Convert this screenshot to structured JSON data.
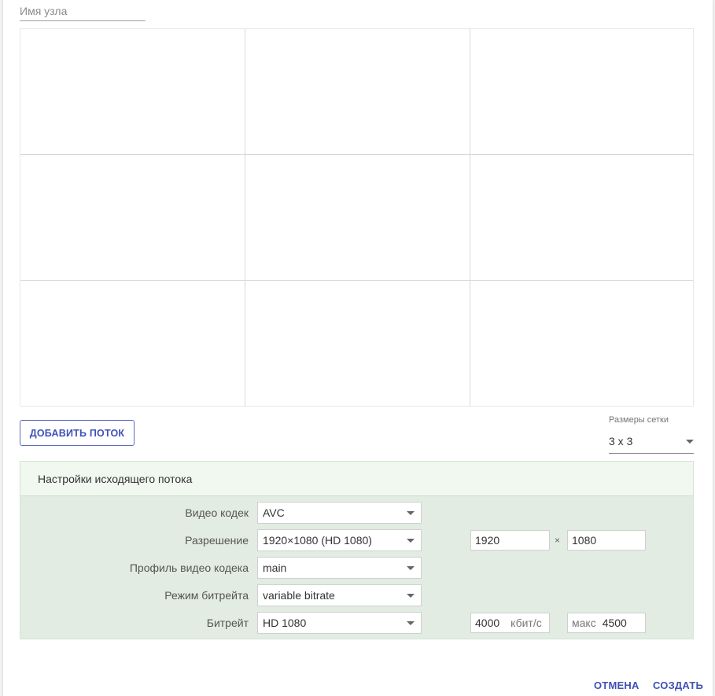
{
  "node_name": {
    "placeholder": "Имя узла",
    "value": ""
  },
  "grid": {
    "rows": 3,
    "cols": 3
  },
  "add_stream_label": "ДОБАВИТЬ ПОТОК",
  "grid_size": {
    "label": "Размеры сетки",
    "value": "3 x 3"
  },
  "output_settings": {
    "title": "Настройки исходящего потока",
    "video_codec": {
      "label": "Видео кодек",
      "value": "AVC"
    },
    "resolution": {
      "label": "Разрешение",
      "value": "1920×1080 (HD 1080)",
      "width": "1920",
      "times": "×",
      "height": "1080"
    },
    "codec_profile": {
      "label": "Профиль видео кодека",
      "value": "main"
    },
    "bitrate_mode": {
      "label": "Режим битрейта",
      "value": "variable bitrate"
    },
    "bitrate": {
      "label": "Битрейт",
      "value": "HD 1080",
      "amount": "4000",
      "unit": "кбит/с",
      "max_prefix": "макс",
      "max_value": "4500"
    }
  },
  "footer": {
    "cancel_label": "ОТМЕНА",
    "create_label": "СОЗДАТЬ"
  },
  "colors": {
    "accent": "#3f51b5",
    "panel_bg": "#e2ece2",
    "panel_header_bg": "#f0f8f0"
  }
}
